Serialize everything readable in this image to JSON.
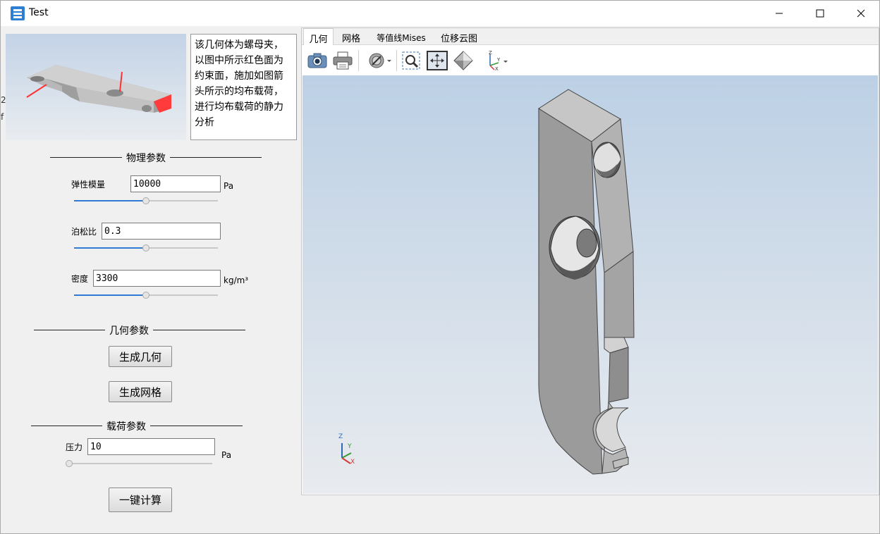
{
  "window": {
    "title": "Test",
    "minimize_glyph": "—",
    "maximize_glyph": "☐",
    "close_glyph": "✕"
  },
  "description": "该几何体为螺母夹，以图中所示红色面为约束面，施加如图箭头所示的均布载荷，进行均布载荷的静力分析",
  "physical": {
    "section_title": "物理参数",
    "elastic_label": "弹性模量",
    "elastic_value": "10000",
    "elastic_unit": "Pa",
    "elastic_slider": 0.5,
    "poisson_label": "泊松比",
    "poisson_value": "0.3",
    "poisson_slider": 0.5,
    "density_label": "密度",
    "density_value": "3300",
    "density_unit": "kg/m³",
    "density_slider": 0.5
  },
  "geometry": {
    "section_title": "几何参数",
    "generate_geometry": "生成几何",
    "generate_mesh": "生成网格"
  },
  "load": {
    "section_title": "载荷参数",
    "pressure_label": "压力",
    "pressure_value": "10",
    "pressure_unit": "Pa",
    "pressure_slider": 0.0,
    "compute_button": "一键计算"
  },
  "tabs": [
    {
      "label": "几何",
      "active": true
    },
    {
      "label": "网格",
      "active": false
    },
    {
      "label": "等值线Mises",
      "active": false
    },
    {
      "label": "位移云图",
      "active": false
    }
  ],
  "toolbar": {
    "icons": [
      "camera-icon",
      "print-icon",
      "hide-show-icon",
      "zoom-region-icon",
      "fit-all-icon",
      "view-projection-icon",
      "axes-orientation-icon"
    ]
  },
  "axes": {
    "x": "X",
    "y": "Y",
    "z": "Z"
  },
  "edge_glyphs": [
    "2",
    "f"
  ],
  "colors": {
    "accent": "#2f7bd4",
    "constraint_face": "#ff3b3b",
    "model_gray": "#a9a9a9",
    "viewport_top": "#bcd0e5"
  }
}
